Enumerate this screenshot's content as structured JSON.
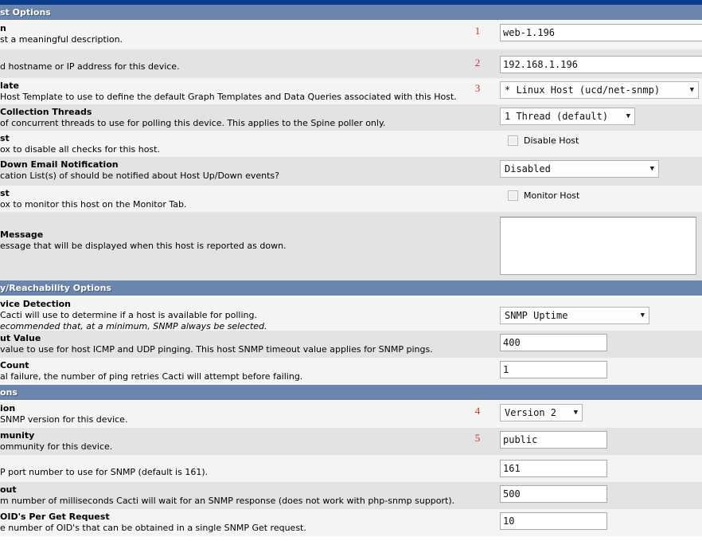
{
  "sections": {
    "host_options": "st Options",
    "availability": "y/Reachability Options",
    "snmp_options": "ons"
  },
  "fields": {
    "description": {
      "title": "n",
      "desc": "st a meaningful description.",
      "value": "web-1.196",
      "marker": "1"
    },
    "hostname": {
      "title": "",
      "desc": "d hostname or IP address for this device.",
      "value": "192.168.1.196",
      "marker": "2"
    },
    "host_template": {
      "title": "late",
      "desc": "Host Template to use to define the default Graph Templates and Data Queries associated with this Host.",
      "value": "* Linux Host (ucd/net-snmp)",
      "marker": "3"
    },
    "collection_threads": {
      "title": "Collection Threads",
      "desc": "of concurrent threads to use for polling this device. This applies to the Spine poller only.",
      "value": "1 Thread (default)"
    },
    "disable_host": {
      "title": "st",
      "desc": "ox to disable all checks for this host.",
      "checkbox_label": "Disable Host",
      "checked": false
    },
    "notification": {
      "title": "Down Email Notification",
      "desc": "cation List(s) of should be notified about Host Up/Down events?",
      "value": "Disabled"
    },
    "monitor_host": {
      "title": "st",
      "desc": "ox to monitor this host on the Monitor Tab.",
      "checkbox_label": "Monitor Host",
      "checked": false
    },
    "down_message": {
      "title": "Message",
      "desc": "essage that will be displayed when this host is reported as down.",
      "value": ""
    },
    "downed_device_detection": {
      "title": "vice Detection",
      "desc": "Cacti will use to determine if a host is available for polling.",
      "desc2": "ecommended that, at a minimum, SNMP always be selected.",
      "value": "SNMP Uptime"
    },
    "ping_timeout": {
      "title": "ut Value",
      "desc": "value to use for host ICMP and UDP pinging. This host SNMP timeout value applies for SNMP pings.",
      "value": "400"
    },
    "ping_retry_count": {
      "title": "Count",
      "desc": "al failure, the number of ping retries Cacti will attempt before failing.",
      "value": "1"
    },
    "snmp_version": {
      "title": "ion",
      "desc": "SNMP version for this device.",
      "value": "Version 2",
      "marker": "4"
    },
    "snmp_community": {
      "title": "munity",
      "desc": "ommunity for this device.",
      "value": "public",
      "marker": "5"
    },
    "snmp_port": {
      "title": "",
      "desc": "P port number to use for SNMP (default is 161).",
      "value": "161"
    },
    "snmp_timeout": {
      "title": "out",
      "desc": "m number of milliseconds Cacti will wait for an SNMP response (does not work with php-snmp support).",
      "value": "500"
    },
    "max_oids": {
      "title": "OID's Per Get Request",
      "desc": "e number of OID's that can be obtained in a single SNMP Get request.",
      "value": "10"
    }
  },
  "icons": {
    "caret": "▼"
  },
  "colors": {
    "top_strip": "#0a3c8c",
    "section_header": "#6b86ad",
    "row_alt": "#e3e3e3",
    "row_plain": "#f4f4f4",
    "marker": "#c0392b"
  }
}
